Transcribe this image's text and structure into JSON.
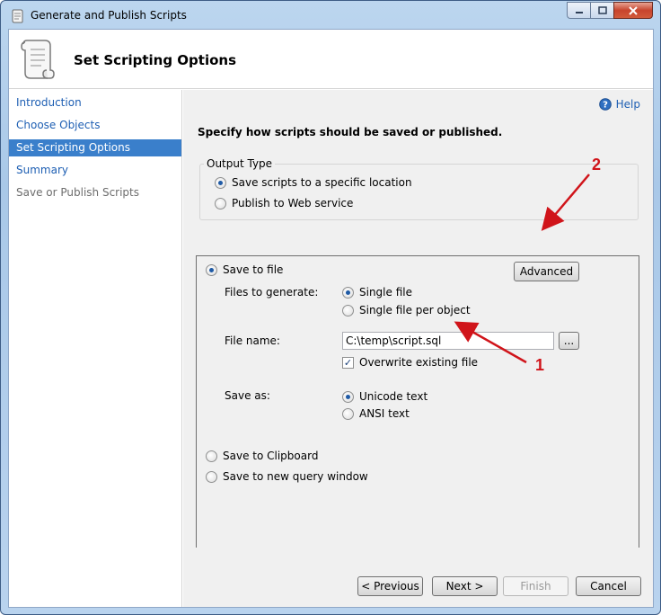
{
  "window": {
    "title": "Generate and Publish Scripts"
  },
  "header": {
    "title": "Set Scripting Options"
  },
  "nav": {
    "items": [
      {
        "label": "Introduction",
        "state": "link"
      },
      {
        "label": "Choose Objects",
        "state": "link"
      },
      {
        "label": "Set Scripting Options",
        "state": "active"
      },
      {
        "label": "Summary",
        "state": "link"
      },
      {
        "label": "Save or Publish Scripts",
        "state": "disabled"
      }
    ]
  },
  "main": {
    "help_label": "Help",
    "instruction": "Specify how scripts should be saved or published.",
    "output_type": {
      "legend": "Output Type",
      "options": [
        {
          "label": "Save scripts to a specific location",
          "selected": true
        },
        {
          "label": "Publish to Web service",
          "selected": false
        }
      ]
    },
    "save_to_file": {
      "label": "Save to file",
      "selected": true,
      "advanced_button": "Advanced",
      "files_to_generate_label": "Files to generate:",
      "files_options": [
        {
          "label": "Single file",
          "selected": true
        },
        {
          "label": "Single file per object",
          "selected": false
        }
      ],
      "file_name_label": "File name:",
      "file_name_value": "C:\\temp\\script.sql",
      "browse_button": "...",
      "overwrite_label": "Overwrite existing file",
      "overwrite_checked": true,
      "save_as_label": "Save as:",
      "save_as_options": [
        {
          "label": "Unicode text",
          "selected": true
        },
        {
          "label": "ANSI text",
          "selected": false
        }
      ]
    },
    "other_destinations": [
      {
        "label": "Save to Clipboard",
        "selected": false
      },
      {
        "label": "Save to new query window",
        "selected": false
      }
    ]
  },
  "footer": {
    "previous": "< Previous",
    "next": "Next >",
    "finish": "Finish",
    "cancel": "Cancel"
  },
  "annotations": {
    "marker_1": "1",
    "marker_2": "2",
    "color": "#d0141a"
  },
  "colors": {
    "accent": "#3a7fcb",
    "link": "#1e5fb3"
  }
}
